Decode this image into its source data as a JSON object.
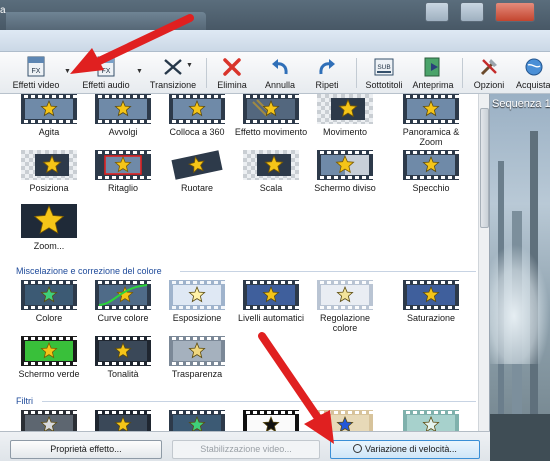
{
  "window": {
    "tab_text": "a"
  },
  "toolbar": {
    "effetti_video": "Effetti video",
    "effetti_audio": "Effetti audio",
    "transizione": "Transizione",
    "elimina": "Elimina",
    "annulla": "Annulla",
    "ripeti": "Ripeti",
    "sottotitoli": "Sottotitoli",
    "anteprima": "Anteprima",
    "opzioni": "Opzioni",
    "acquista": "Acquista",
    "fx_label": "FX",
    "sub_label": "SUB"
  },
  "effects": {
    "row1": [
      "Agita",
      "Avvolgi",
      "Colloca a 360",
      "Effetto movimento",
      "Movimento",
      "Panoramica &",
      "Zoom"
    ],
    "row2": [
      "Posiziona",
      "Ritaglio",
      "Ruotare",
      "Scala",
      "Schermo diviso",
      "Specchio"
    ],
    "row3": [
      "Zoom..."
    ],
    "section_color": "Miscelazione e correzione del colore",
    "color_row1": [
      "Colore",
      "Curve colore",
      "Esposizione",
      "Livelli automatici",
      "Regolazione colore",
      "Saturazione"
    ],
    "color_row2": [
      "Schermo verde",
      "Tonalità",
      "Trasparenza"
    ],
    "section_filters": "Filtri"
  },
  "preview": {
    "sequence_label": "Sequenza 1"
  },
  "bottom": {
    "proprieta": "Proprietà effetto...",
    "stabilizzazione": "Stabilizzazione video...",
    "variazione": "Variazione di velocità..."
  },
  "colors": {
    "accent_red": "#e02020",
    "section_blue": "#1e4a9a",
    "star_gold": "#f5c518"
  }
}
